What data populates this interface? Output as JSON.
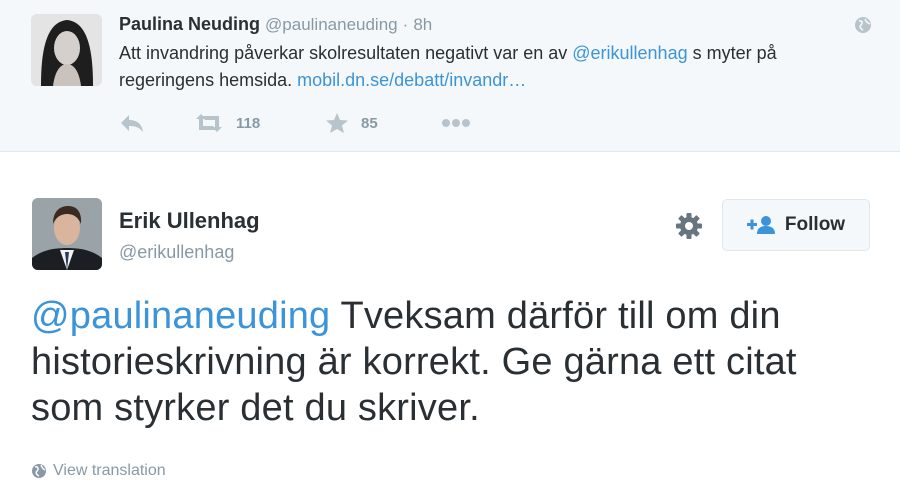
{
  "parent_tweet": {
    "name": "Paulina Neuding",
    "screen_name": "@paulinaneuding",
    "separator": "·",
    "time": "8h",
    "text_part1": "Att invandring påverkar skolresultaten negativt var en av ",
    "mention": "@erikullenhag",
    "text_part2": " s myter på regeringens hemsida. ",
    "url": "mobil.dn.se/debatt/invandr…",
    "retweet_count": "118",
    "favorite_count": "85",
    "icons": {
      "reply": "reply-icon",
      "retweet": "retweet-icon",
      "favorite": "star-icon",
      "more": "more-icon",
      "globe": "globe-icon"
    }
  },
  "main_tweet": {
    "name": "Erik Ullenhag",
    "screen_name": "@erikullenhag",
    "follow_label": "Follow",
    "mention": "@paulinaneuding",
    "text": " Tveksam därför till om din historieskrivning är korrekt. Ge gärna ett citat som styrker det du skriver.",
    "view_translation": "View translation"
  },
  "colors": {
    "link": "#3b94d9",
    "muted": "#8899a6",
    "text": "#292f33",
    "parent_bg": "#f5f8fa"
  }
}
